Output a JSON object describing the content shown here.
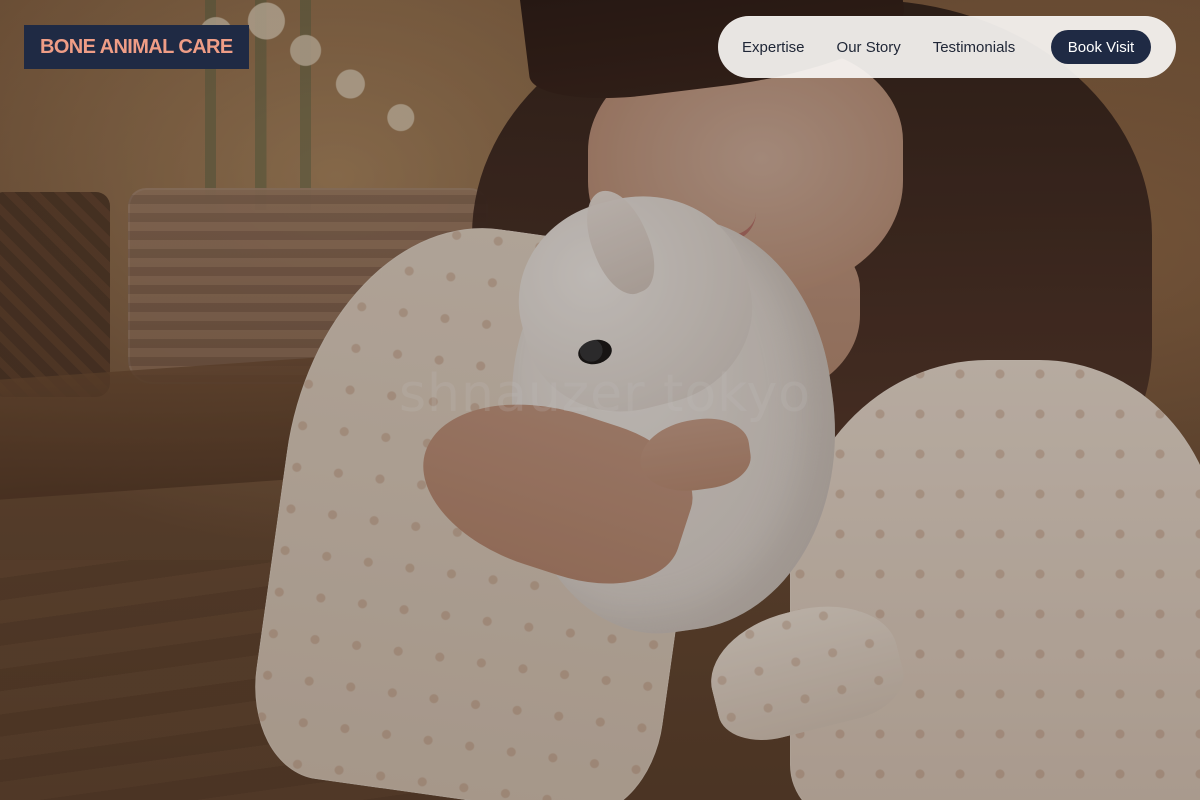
{
  "brand": {
    "label": "BONE ANIMAL CARE"
  },
  "nav": {
    "items": [
      {
        "label": "Expertise"
      },
      {
        "label": "Our Story"
      },
      {
        "label": "Testimonials"
      }
    ],
    "cta": "Book Visit"
  },
  "hero": {
    "watermark": "shnauzer tokyo"
  },
  "colors": {
    "brand_bg": "#1f2a44",
    "brand_text": "#ef9d86",
    "nav_bg": "#f8f6f4",
    "cta_bg": "#1f2a44",
    "cta_text": "#ffffff"
  }
}
